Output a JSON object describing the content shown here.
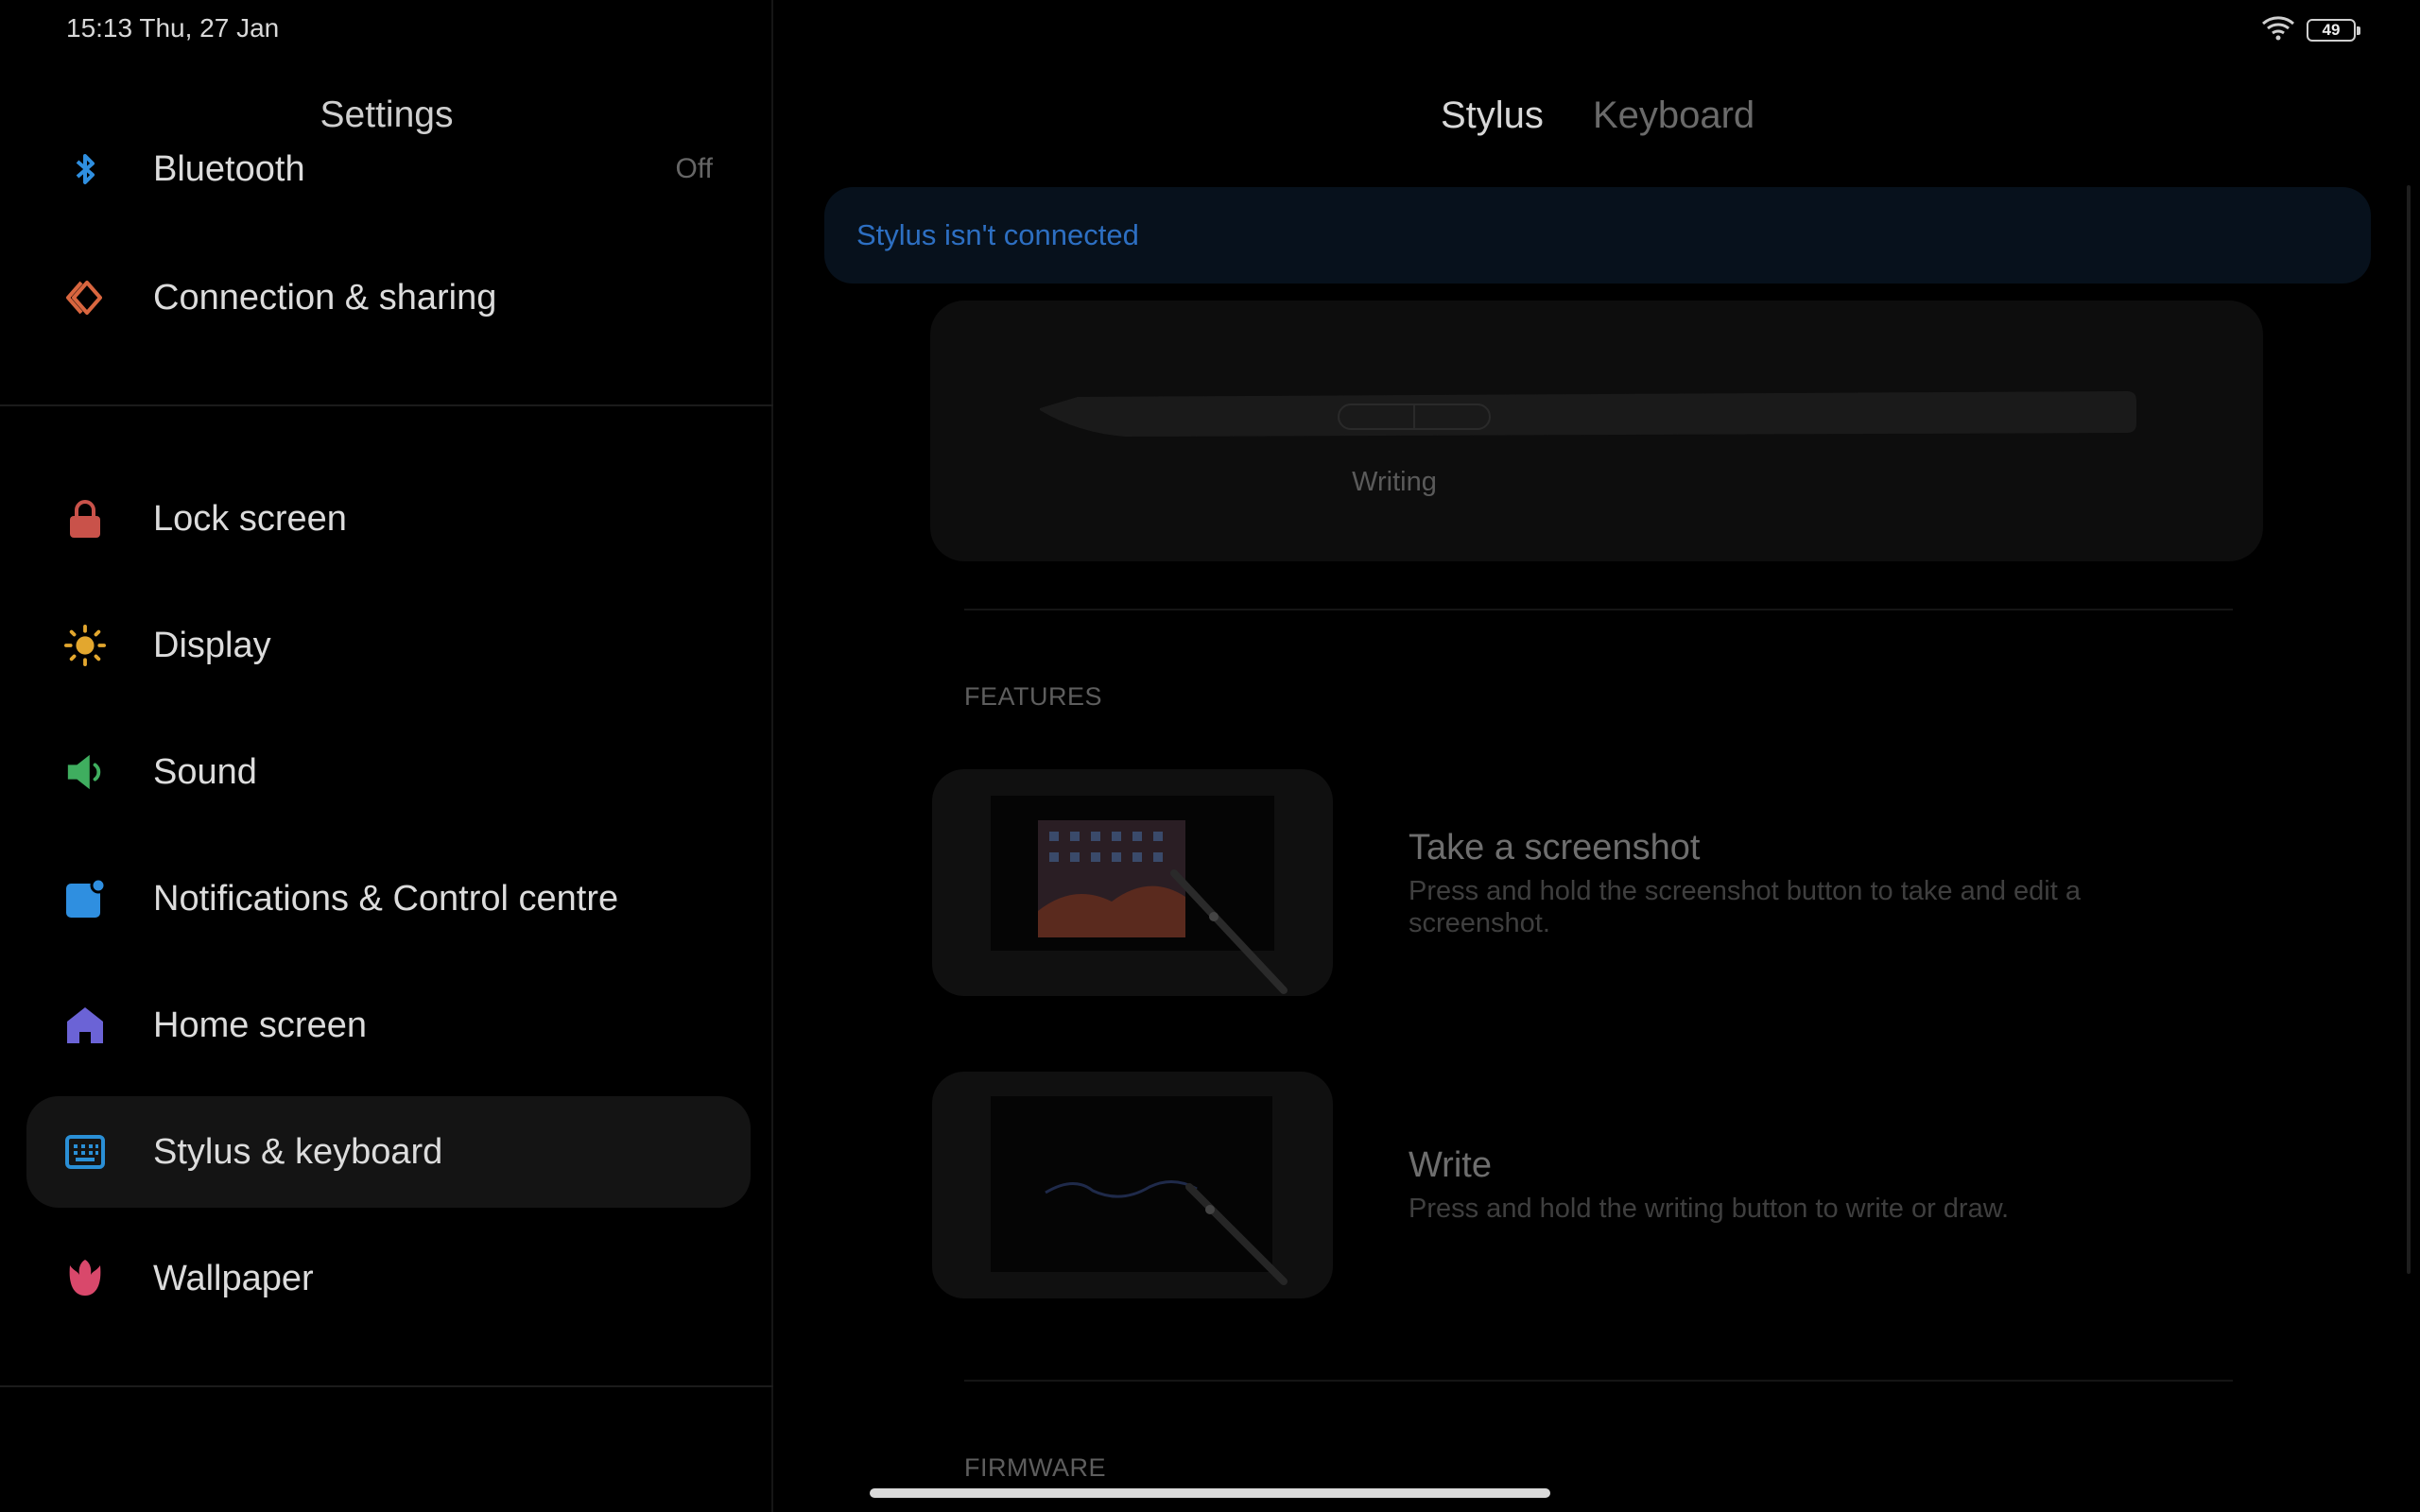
{
  "status_bar": {
    "time_date": "15:13  Thu, 27 Jan",
    "battery": "49"
  },
  "left_pane": {
    "title": "Settings",
    "items": [
      {
        "label": "Bluetooth",
        "value": "Off"
      },
      {
        "label": "Connection & sharing"
      },
      {
        "label": "Lock screen"
      },
      {
        "label": "Display"
      },
      {
        "label": "Sound"
      },
      {
        "label": "Notifications & Control centre"
      },
      {
        "label": "Home screen"
      },
      {
        "label": "Stylus & keyboard"
      },
      {
        "label": "Wallpaper"
      }
    ]
  },
  "right_pane": {
    "tabs": [
      {
        "label": "Stylus"
      },
      {
        "label": "Keyboard"
      }
    ],
    "banner": "Stylus isn't connected",
    "stylus_caption": "Writing",
    "features_heading": "FEATURES",
    "features": [
      {
        "title": "Take a screenshot",
        "description": "Press and hold the screenshot button to take and edit a screenshot."
      },
      {
        "title": "Write",
        "description": "Press and hold the writing button to write or draw."
      }
    ],
    "firmware_heading": "FIRMWARE"
  },
  "colors": {
    "accent_blue": "#2d6fc2",
    "connection_icon": "#d9663f",
    "lock_icon": "#c9524a",
    "display_icon": "#e3a72e",
    "sound_icon": "#3fae5f",
    "notifications_icon": "#2f8fe0",
    "home_icon": "#6b63d6",
    "stylus_icon": "#2a8fd6",
    "wallpaper_icon": "#d9486b"
  }
}
